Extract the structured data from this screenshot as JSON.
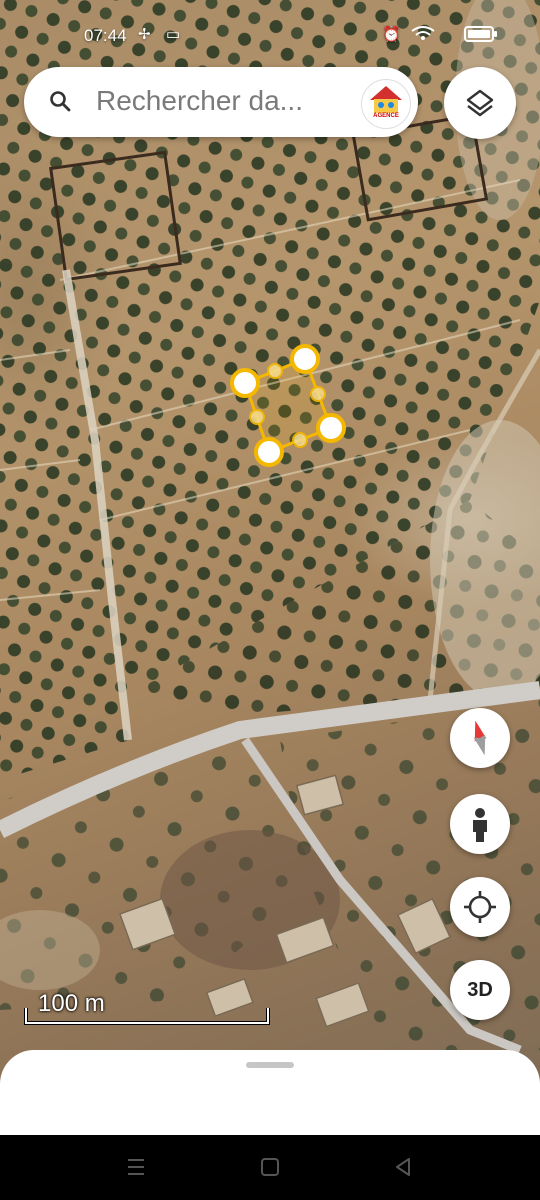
{
  "status_bar": {
    "time": "07:44",
    "icons": [
      "fan-icon",
      "cast-icon",
      "alarm-icon",
      "wifi-icon",
      "battery-icon"
    ]
  },
  "search": {
    "placeholder": "Rechercher da...",
    "avatar_label": "AGENCE",
    "icon": "search-icon"
  },
  "map_controls": {
    "layers_icon": "layers-icon",
    "compass_icon": "compass-icon",
    "street_view_icon": "person-icon",
    "my_location_icon": "crosshair-icon",
    "three_d_label": "3D"
  },
  "scale": {
    "label": "100 m"
  },
  "colors": {
    "polygon_stroke": "#f5b800",
    "compass_red": "#e53935"
  },
  "navbar": {
    "icons": [
      "menu-icon",
      "home-icon",
      "back-icon"
    ]
  }
}
